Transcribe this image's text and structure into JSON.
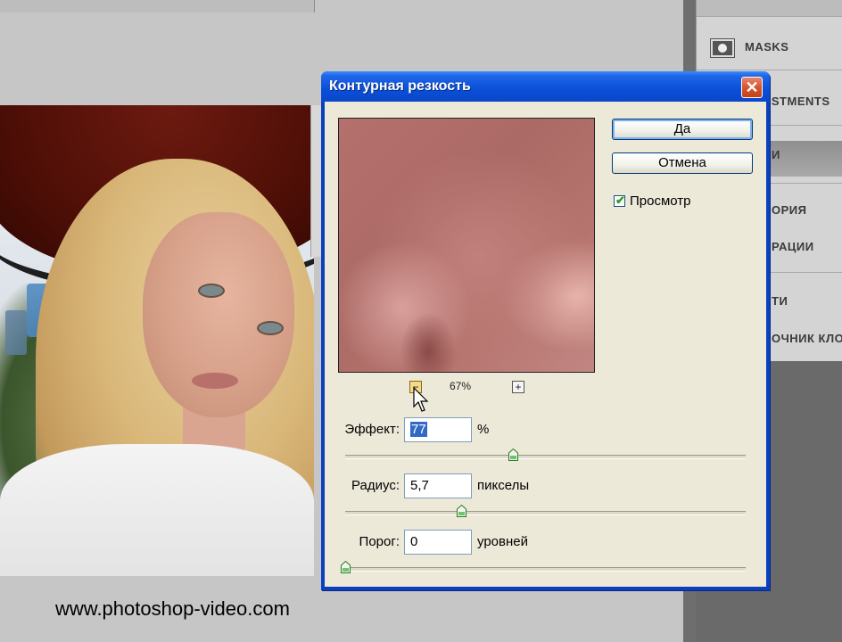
{
  "dialog": {
    "title": "Контурная резкость",
    "close_glyph": "✕",
    "ok_label": "Да",
    "cancel_label": "Отмена",
    "preview_checkbox": {
      "label": "Просмотр",
      "checked": true
    },
    "zoom": {
      "minus": "−",
      "plus": "+",
      "level": "67%"
    },
    "fields": {
      "amount": {
        "label": "Эффект:",
        "value": "77",
        "unit": "%",
        "slider_fraction": 0.42
      },
      "radius": {
        "label": "Радиус:",
        "value": "5,7",
        "unit": "пикселы",
        "slider_fraction": 0.29
      },
      "threshold": {
        "label": "Порог:",
        "value": "0",
        "unit": "уровней",
        "slider_fraction": 0.0
      }
    }
  },
  "panels": {
    "masks": "MASKS",
    "adjustments": "USTMENTS",
    "partial1": "И",
    "history": "ОРИЯ",
    "actions": "РАЦИИ",
    "partial2": "ТИ",
    "clone_source": "ОЧНИК КЛО"
  },
  "watermark": "www.photoshop-video.com",
  "colors": {
    "titlebar": "#0a4fd8",
    "dialog_bg": "#ece9d8",
    "selection": "#316ac5",
    "checkmark": "#21a121"
  }
}
